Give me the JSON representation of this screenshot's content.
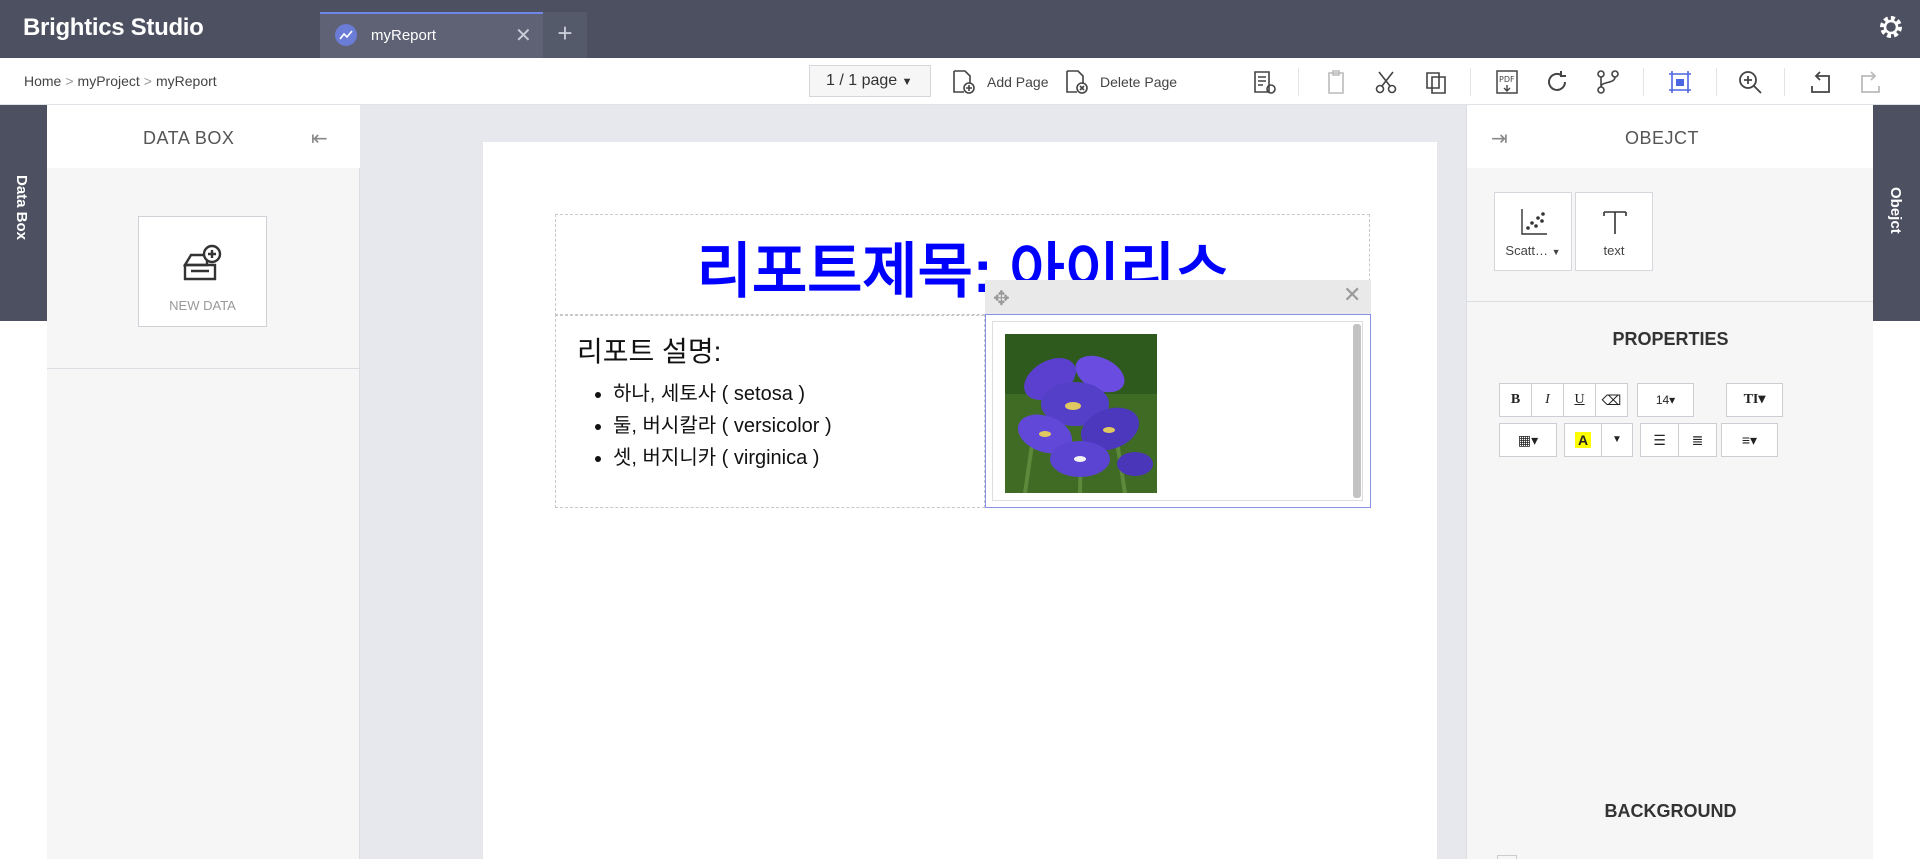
{
  "app": {
    "title": "Brightics Studio"
  },
  "tabs": [
    {
      "label": "myReport",
      "close": "✕"
    }
  ],
  "tab_add": "+",
  "breadcrumb": {
    "items": [
      "Home",
      "myProject",
      "myReport"
    ],
    "separator": ">"
  },
  "toolbar": {
    "page_select": "1 / 1 page",
    "add_page": "Add Page",
    "delete_page": "Delete Page"
  },
  "sidebar_left": {
    "strip_label": "Data Box",
    "title": "DATA BOX",
    "collapse_glyph": "⇤",
    "new_data_label": "NEW DATA"
  },
  "report": {
    "title": "리포트제목: 아이리스",
    "title_color": "#0000ff",
    "description_title": "리포트 설명:",
    "bullets": [
      "하나, 세토사 ( setosa )",
      "둘, 버시칼라 ( versicolor )",
      "셋, 버지니카 ( virginica )"
    ],
    "image_move_glyph": "✥",
    "image_close_glyph": "✕"
  },
  "sidebar_right": {
    "strip_label": "Obejct",
    "title": "OBEJCT",
    "collapse_glyph": "⇥",
    "objects": [
      {
        "label": "Scatt…",
        "icon": "scatter-chart-icon"
      },
      {
        "label": "text",
        "icon": "text-icon"
      }
    ],
    "properties_title": "PROPERTIES",
    "font_size": "14▾",
    "background_title": "BACKGROUND"
  },
  "colors": {
    "topbar": "#4d5060",
    "accent": "#6f85e8",
    "title_blue": "#0000ff"
  }
}
